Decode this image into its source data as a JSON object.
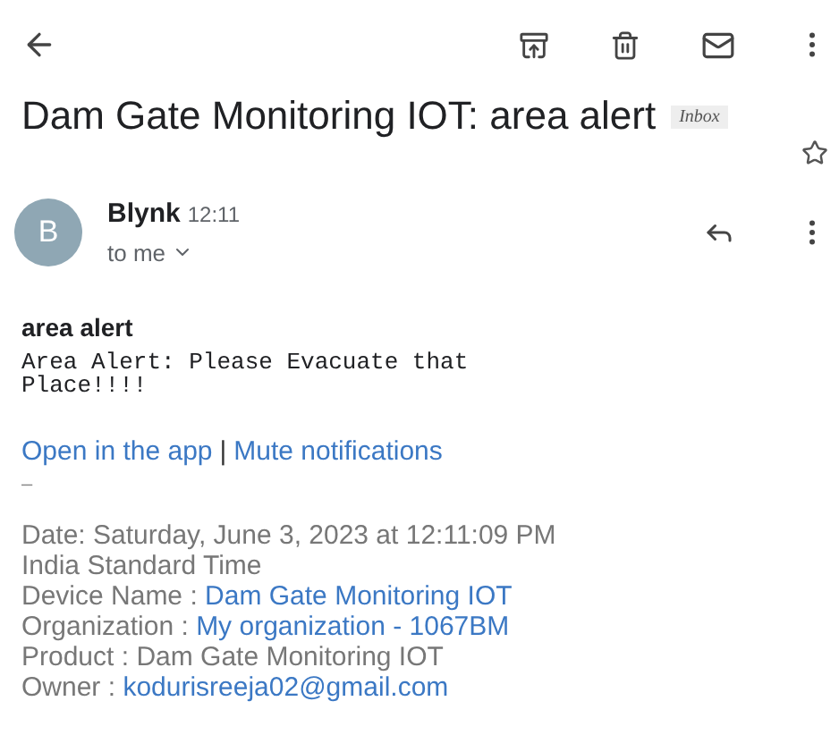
{
  "subject": {
    "title": "Dam Gate Monitoring IOT: area alert",
    "label": "Inbox",
    "starred": false
  },
  "sender": {
    "initial": "B",
    "name": "Blynk",
    "time": "12:11",
    "recipient": "to me"
  },
  "body": {
    "heading": "area alert",
    "message": "Area Alert: Please Evacuate that Place!!!!",
    "links": [
      "Open in the app",
      "Mute notifications"
    ],
    "separator": "|",
    "dash": "–",
    "details": [
      {
        "kind": "text",
        "label": "Date: Saturday, June 3, 2023 at 12:11:09 PM India Standard Time"
      },
      {
        "kind": "link",
        "label": "Device Name : ",
        "value": "Dam Gate Monitoring IOT"
      },
      {
        "kind": "link",
        "label": "Organization : ",
        "value": "My organization - 1067BM"
      },
      {
        "kind": "text",
        "label": "Product : Dam Gate Monitoring IOT"
      },
      {
        "kind": "link",
        "label": "Owner : ",
        "value": "kodurisreeja02@gmail.com"
      }
    ]
  }
}
